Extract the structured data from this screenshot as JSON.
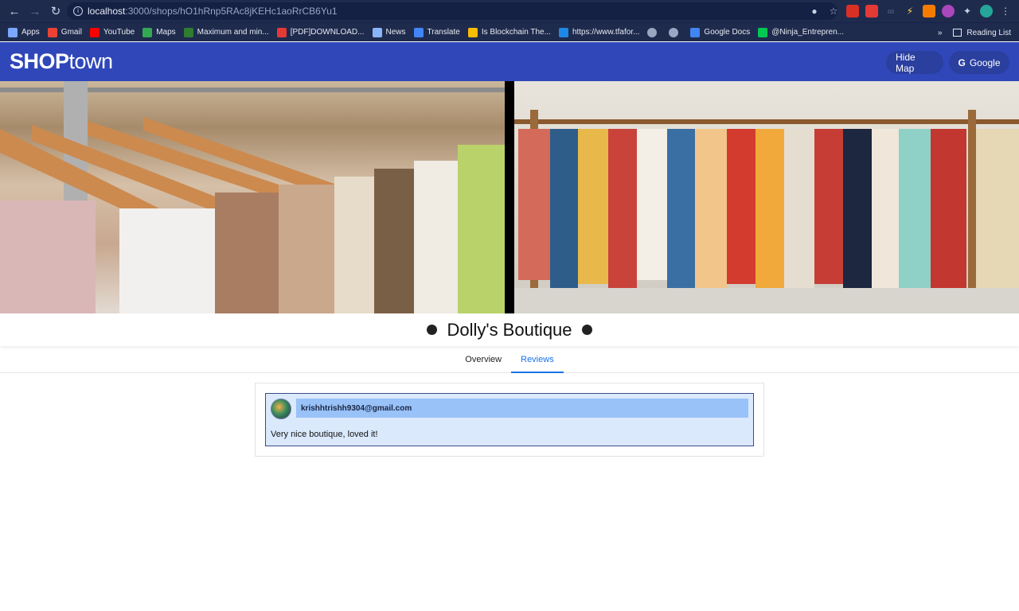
{
  "browser": {
    "url_host": "localhost",
    "url_rest": ":3000/shops/hO1hRnp5RAc8jKEHc1aoRrCB6Yu1",
    "bookmarks": [
      {
        "label": "Apps",
        "color": "#7aa7ff"
      },
      {
        "label": "Gmail",
        "color": "#ea4335"
      },
      {
        "label": "YouTube",
        "color": "#ff0000"
      },
      {
        "label": "Maps",
        "color": "#34a853"
      },
      {
        "label": "Maximum and min...",
        "color": "#2e7d32"
      },
      {
        "label": "[PDF]DOWNLOAD...",
        "color": "#e53935"
      },
      {
        "label": "News",
        "color": "#8ab4f8"
      },
      {
        "label": "Translate",
        "color": "#4285f4"
      },
      {
        "label": "Is Blockchain The...",
        "color": "#fbbc05"
      },
      {
        "label": "https://www.tfafor...",
        "color": "#1e88e5"
      },
      {
        "label": "",
        "color": "#9aa6c2"
      },
      {
        "label": "",
        "color": "#9aa6c2"
      },
      {
        "label": "Google Docs",
        "color": "#4285f4"
      },
      {
        "label": "@Ninja_Entrepren...",
        "color": "#00c853"
      }
    ],
    "more_label": "»",
    "reading_list": "Reading List"
  },
  "header": {
    "logo_bold": "SHOP",
    "logo_light": "town",
    "hide_map": "Hide Map",
    "google": "Google",
    "google_glyph": "G"
  },
  "shop": {
    "name": "Dolly's Boutique"
  },
  "tabs": [
    {
      "label": "Overview",
      "active": false
    },
    {
      "label": "Reviews",
      "active": true
    }
  ],
  "reviews": [
    {
      "email": "krishhtrishh9304@gmail.com",
      "text": "Very nice boutique, loved it!"
    }
  ],
  "colors": {
    "header_bg": "#2f47b9",
    "tab_active": "#1a73e8",
    "review_bg": "#dbe9fd",
    "email_bg": "#98c2f8"
  }
}
